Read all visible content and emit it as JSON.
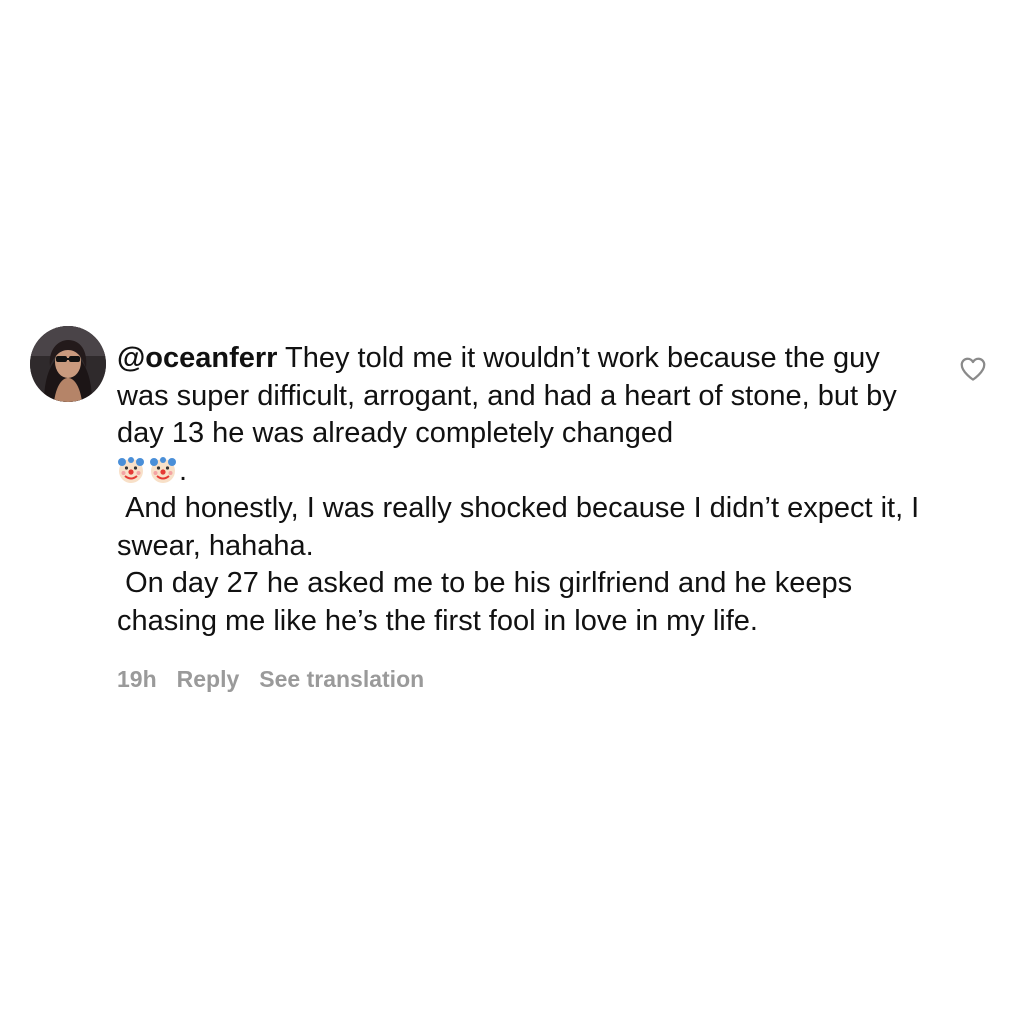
{
  "comment": {
    "username": "@oceanferr",
    "lines": [
      "They told me it wouldn’t work because the guy was super difficult, arrogant, and had a heart of stone, but by day 13 he was already completely changed",
      " And honestly, I was really shocked because I didn’t expect it, I swear, hahaha.",
      " On day 27 he asked me to be his girlfriend and he keeps chasing me like he’s the first fool in love in my life."
    ],
    "emoji_suffix": ".",
    "emojis": [
      "clown-face",
      "clown-face"
    ],
    "meta": {
      "time": "19h",
      "reply": "Reply",
      "translate": "See translation"
    }
  },
  "icons": {
    "like": "heart-outline-icon",
    "avatar": "user-avatar"
  }
}
